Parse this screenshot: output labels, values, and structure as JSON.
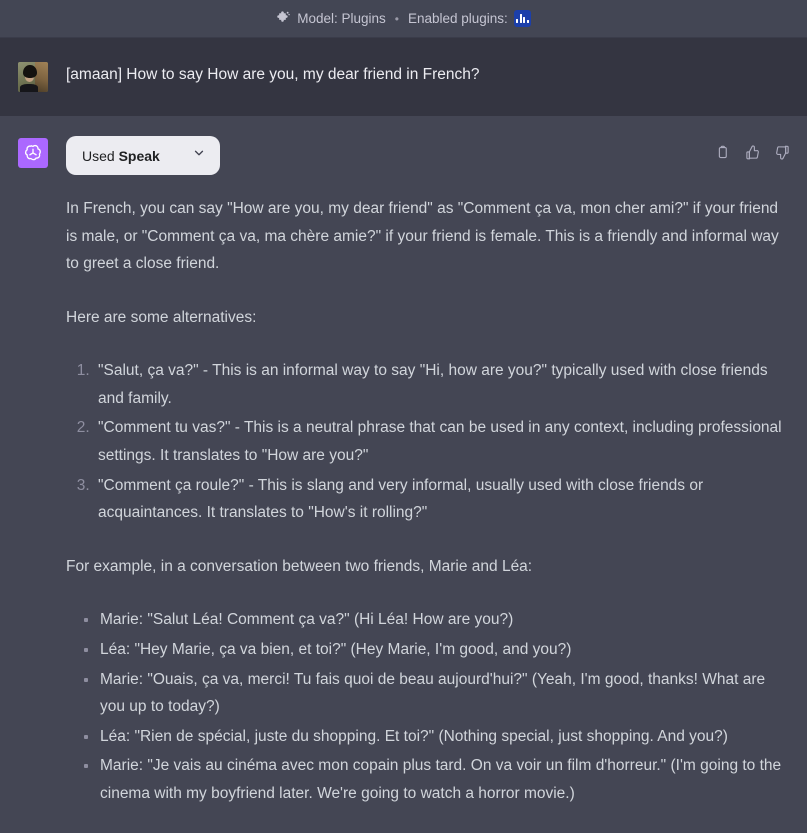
{
  "topbar": {
    "model_icon": "puzzle-piece-icon",
    "model_label": "Model: Plugins",
    "separator": "•",
    "plugins_label": "Enabled plugins:",
    "plugin_icon": "speak-waveform-icon"
  },
  "user_message": {
    "avatar": "user-photo-avatar",
    "text": "[amaan] How to say How are you, my dear friend in French?"
  },
  "assistant_message": {
    "avatar": "openai-logo-avatar",
    "plugin_pill": {
      "prefix": "Used ",
      "name": "Speak",
      "chevron": "chevron-down-icon"
    },
    "actions": [
      {
        "name": "copy-icon",
        "label": "Copy"
      },
      {
        "name": "thumbs-up-icon",
        "label": "Good response"
      },
      {
        "name": "thumbs-down-icon",
        "label": "Bad response"
      }
    ],
    "paragraph_1": "In French, you can say \"How are you, my dear friend\" as \"Comment ça va, mon cher ami?\" if your friend is male, or \"Comment ça va, ma chère amie?\" if your friend is female. This is a friendly and informal way to greet a close friend.",
    "paragraph_2": "Here are some alternatives:",
    "alternatives": [
      "\"Salut, ça va?\" - This is an informal way to say \"Hi, how are you?\" typically used with close friends and family.",
      "\"Comment tu vas?\" - This is a neutral phrase that can be used in any context, including professional settings. It translates to \"How are you?\"",
      "\"Comment ça roule?\" - This is slang and very informal, usually used with close friends or acquaintances. It translates to \"How's it rolling?\""
    ],
    "paragraph_3": "For example, in a conversation between two friends, Marie and Léa:",
    "dialogue": [
      "Marie: \"Salut Léa! Comment ça va?\" (Hi Léa! How are you?)",
      "Léa: \"Hey Marie, ça va bien, et toi?\" (Hey Marie, I'm good, and you?)",
      "Marie: \"Ouais, ça va, merci! Tu fais quoi de beau aujourd'hui?\" (Yeah, I'm good, thanks! What are you up to today?)",
      "Léa: \"Rien de spécial, juste du shopping. Et toi?\" (Nothing special, just shopping. And you?)",
      "Marie: \"Je vais au cinéma avec mon copain plus tard. On va voir un film d'horreur.\" (I'm going to the cinema with my boyfriend later. We're going to watch a horror movie.)"
    ]
  },
  "colors": {
    "topbar_bg": "#434654",
    "user_bg": "#343541",
    "assistant_bg": "#444654",
    "accent_purple": "#ab68ff",
    "plugin_blue": "#1c3faa",
    "text_primary": "#ececf1",
    "text_body": "#d1d5db",
    "text_muted": "#8e8ea0",
    "pill_bg": "#ececf1"
  }
}
